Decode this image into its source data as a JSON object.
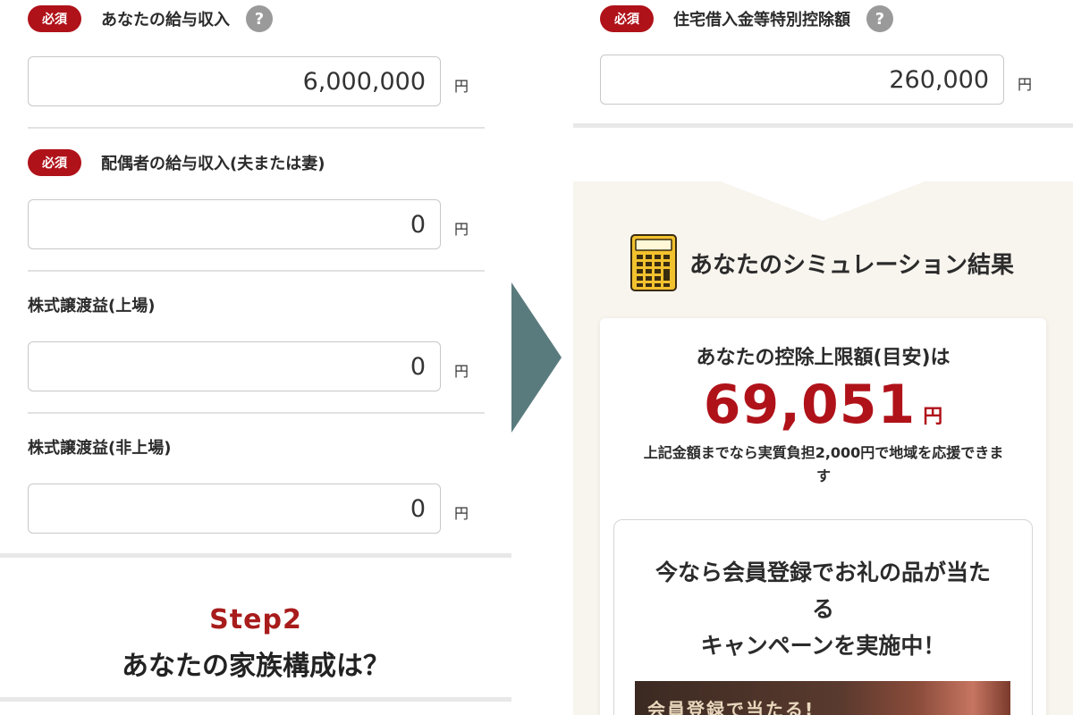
{
  "left": {
    "fields": [
      {
        "required": true,
        "required_label": "必須",
        "label": "あなたの給与収入",
        "help": "?",
        "value": "6,000,000",
        "unit": "円"
      },
      {
        "required": true,
        "required_label": "必須",
        "label": "配偶者の給与収入(夫または妻)",
        "value": "0",
        "unit": "円"
      },
      {
        "required": false,
        "label": "株式譲渡益(上場)",
        "value": "0",
        "unit": "円"
      },
      {
        "required": false,
        "label": "株式譲渡益(非上場)",
        "value": "0",
        "unit": "円"
      }
    ],
    "step": {
      "title": "Step2",
      "question": "あなたの家族構成は？"
    }
  },
  "right": {
    "field": {
      "required_label": "必須",
      "label": "住宅借入金等特別控除額",
      "help": "?",
      "value": "260,000",
      "unit": "円"
    },
    "result": {
      "heading": "あなたのシミュレーション結果",
      "limit_label": "あなたの控除上限額(目安)は",
      "limit_value": "69,051",
      "limit_unit": "円",
      "note_line1": "上記金額までなら実質負担2,000円で地域を応援できま",
      "note_line2": "す"
    },
    "campaign": {
      "line1": "今なら会員登録でお礼の品が当た",
      "line2": "る",
      "line3": "キャンペーンを実施中！",
      "banner_text": "会員登録で当たる!"
    }
  },
  "colors": {
    "accent_red": "#b0121a",
    "arrow": "#5a7b7e",
    "result_bg": "#f8f4ee"
  }
}
